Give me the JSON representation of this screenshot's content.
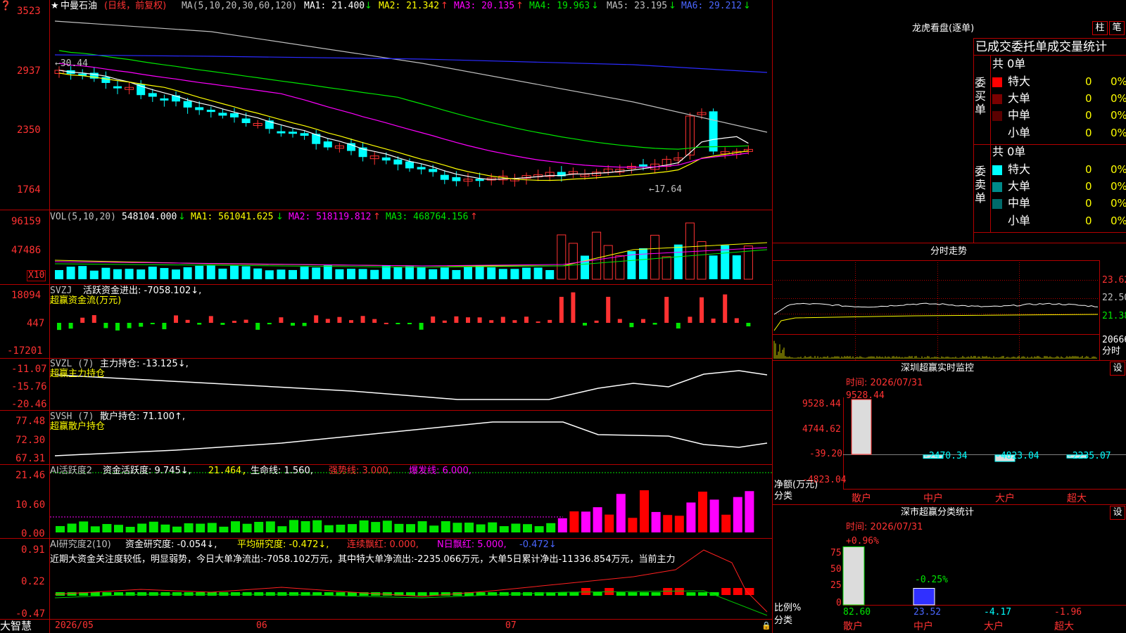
{
  "colors": {
    "up": "#ff3232",
    "down": "#00ffff",
    "ma1": "#ffffff",
    "ma2": "#ffff00",
    "ma3": "#ff00ff",
    "ma4": "#00e600",
    "ma5": "#c0c0c0",
    "ma6": "#2b2bff",
    "grid": "#b40000",
    "bg": "#000000"
  },
  "main_panel": {
    "star_label": "★",
    "stock_name": "中曼石油",
    "period_label": "(日线，前复权)",
    "ma_label": "MA(5,10,20,30,60,120)",
    "ma_items": [
      {
        "label": "MA1: 21.400",
        "arrow": "↓"
      },
      {
        "label": "MA2: 21.342",
        "arrow": "↑"
      },
      {
        "label": "MA3: 20.135",
        "arrow": "↑"
      },
      {
        "label": "MA4: 19.963",
        "arrow": "↓"
      },
      {
        "label": "MA5: 23.195",
        "arrow": "↓"
      },
      {
        "label": "MA6: 29.212",
        "arrow": "↓"
      }
    ],
    "y_ticks": [
      "3523",
      "2937",
      "2350",
      "1764"
    ],
    "high_mark": "←30.44",
    "low_mark": "←17.64"
  },
  "vol_panel": {
    "label": "VOL(5,10,20)",
    "value": "548104.000",
    "value_arrow": "↓",
    "ma_items": [
      {
        "label": "MA1: 561041.625",
        "arrow": "↓"
      },
      {
        "label": "MA2: 518119.812",
        "arrow": "↑"
      },
      {
        "label": "MA3: 468764.156",
        "arrow": "↑"
      }
    ],
    "y_ticks": [
      "96159",
      "47486"
    ],
    "unit": "X10"
  },
  "svzj_panel": {
    "label": "SVZJ",
    "desc": "活跃资金进出: -7058.102↓,",
    "sub": "超赢资金流(万元)",
    "y_ticks": [
      "18094",
      "447",
      "-17201"
    ]
  },
  "svzl_panel": {
    "label": "SVZL (7)",
    "desc": "主力持仓: -13.125↓,",
    "sub": "超赢主力持仓",
    "y_ticks": [
      "-11.07",
      "-15.76",
      "-20.46"
    ]
  },
  "svsh_panel": {
    "label": "SVSH (7)",
    "desc": "散户持仓: 71.100↑,",
    "sub": "超赢散户持仓",
    "y_ticks": [
      "77.48",
      "72.30",
      "67.31"
    ]
  },
  "ai_active": {
    "label": "AI活跃度2",
    "desc": "资金活跃度: 9.745↓,",
    "v2": "21.464,",
    "v3": "生命线: 1.560,",
    "v4": "强势线: 3.000,",
    "v5": "爆发线: 6.000,",
    "y_ticks": [
      "21.46",
      "10.60",
      "0.00"
    ]
  },
  "ai_research": {
    "label": "AI研究度2(10)",
    "desc": "资金研究度: -0.054↓,",
    "v2": "平均研究度: -0.472↓,",
    "v3": "连续飘红: 0.000,",
    "v4": "N日飘红: 5.000,",
    "v5": "-0.472↓",
    "comment": "近期大资金关注度较低，明显弱势，今日大单净流出:-7058.102万元，其中特大单净流出:-2235.066万元，大单5日累计净出-11336.854万元，当前主力",
    "y_ticks": [
      "0.91",
      "0.22",
      "-0.47"
    ]
  },
  "x_axis": {
    "labels": [
      "2026/05",
      "06",
      "07"
    ],
    "brand": "大智慧"
  },
  "lhb": {
    "title": "龙虎看盘(逐单)",
    "btn_bar": "柱",
    "btn_detail": "笔",
    "header": "已成交委托单成交量统计",
    "buy": {
      "side": "委买单",
      "total": "共 0单",
      "rows": [
        {
          "name": "特大",
          "count": "0",
          "pct": "0%"
        },
        {
          "name": "大单",
          "count": "0",
          "pct": "0%"
        },
        {
          "name": "中单",
          "count": "0",
          "pct": "0%"
        },
        {
          "name": "小单",
          "count": "0",
          "pct": "0%"
        }
      ]
    },
    "sell": {
      "side": "委卖单",
      "total": "共 0单",
      "rows": [
        {
          "name": "特大",
          "count": "0",
          "pct": "0%"
        },
        {
          "name": "大单",
          "count": "0",
          "pct": "0%"
        },
        {
          "name": "中单",
          "count": "0",
          "pct": "0%"
        },
        {
          "name": "小单",
          "count": "0",
          "pct": "0%"
        }
      ]
    }
  },
  "intraday": {
    "title": "分时走势",
    "price_ticks": [
      "23.62",
      "22.50",
      "21.38"
    ],
    "vol_tick": "20666",
    "vol_unit": "分时"
  },
  "monitor": {
    "title": "深圳超赢实时监控",
    "btn": "设",
    "time_label": "时间: 2026/07/31",
    "y_ticks": [
      "9528.44",
      "4744.62",
      "-39.20",
      "-4823.04"
    ],
    "y_title": "净额(万元)",
    "x_title": "分类",
    "bars": [
      {
        "cat": "散户",
        "value": 9528.44,
        "label": "9528.44"
      },
      {
        "cat": "中户",
        "value": -2470.34,
        "label": "-2470.34"
      },
      {
        "cat": "大户",
        "value": -4823.04,
        "label": "-4823.04"
      },
      {
        "cat": "超大",
        "value": -2235.07,
        "label": "-2235.07"
      }
    ]
  },
  "classify": {
    "title": "深市超赢分类统计",
    "btn": "设",
    "time_label": "时间: 2026/07/31",
    "top_pct": "+0.96%",
    "mid_pct": "-0.25%",
    "y_ticks": [
      "75",
      "50",
      "25",
      "0"
    ],
    "y_title": "比例%",
    "x_title": "分类",
    "bars": [
      {
        "cat": "散户",
        "value": 82.6,
        "label": "82.60"
      },
      {
        "cat": "中户",
        "value": 23.52,
        "label": "23.52"
      },
      {
        "cat": "大户",
        "value": -4.17,
        "label": "-4.17"
      },
      {
        "cat": "超大",
        "value": -1.96,
        "label": "-1.96"
      }
    ]
  }
}
